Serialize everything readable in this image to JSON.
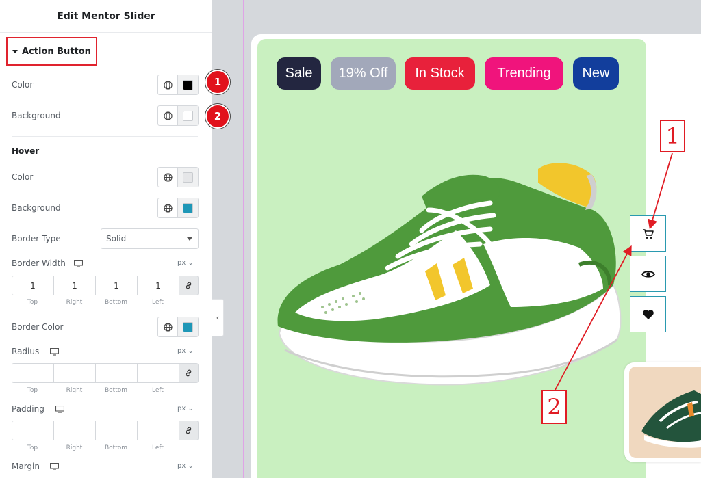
{
  "panel": {
    "title": "Edit Mentor Slider",
    "section_title": "Action Button",
    "color_label": "Color",
    "background_label": "Background",
    "hover_heading": "Hover",
    "hover_color_label": "Color",
    "hover_background_label": "Background",
    "border_type_label": "Border Type",
    "border_type_value": "Solid",
    "border_width_label": "Border Width",
    "border_width_unit": "px",
    "border_width_values": [
      "1",
      "1",
      "1",
      "1"
    ],
    "side_labels": [
      "Top",
      "Right",
      "Bottom",
      "Left"
    ],
    "border_color_label": "Border Color",
    "radius_label": "Radius",
    "radius_unit": "px",
    "padding_label": "Padding",
    "padding_unit": "px",
    "margin_label": "Margin",
    "margin_unit": "px",
    "collapse_icon": "‹"
  },
  "swatches": {
    "color": "#000000",
    "background": "#ffffff",
    "hover_color": "#e5e6e8",
    "hover_background": "#1e97b7",
    "border_color": "#1e97b7"
  },
  "badges": [
    "1",
    "2"
  ],
  "tags": [
    {
      "label": "Sale",
      "color": "#232640"
    },
    {
      "label": "19% Off",
      "color": "#a2a8ba"
    },
    {
      "label": "In Stock",
      "color": "#e8213b"
    },
    {
      "label": "Trending",
      "color": "#f0147c"
    },
    {
      "label": "New",
      "color": "#123e9c"
    }
  ],
  "action_icons": [
    "cart-icon",
    "eye-icon",
    "heart-icon"
  ],
  "callouts": [
    "1",
    "2"
  ],
  "colors": {
    "highlight_red": "#e01c24",
    "slide_bg": "#c9f0c0",
    "action_border": "#2a9ab0"
  }
}
